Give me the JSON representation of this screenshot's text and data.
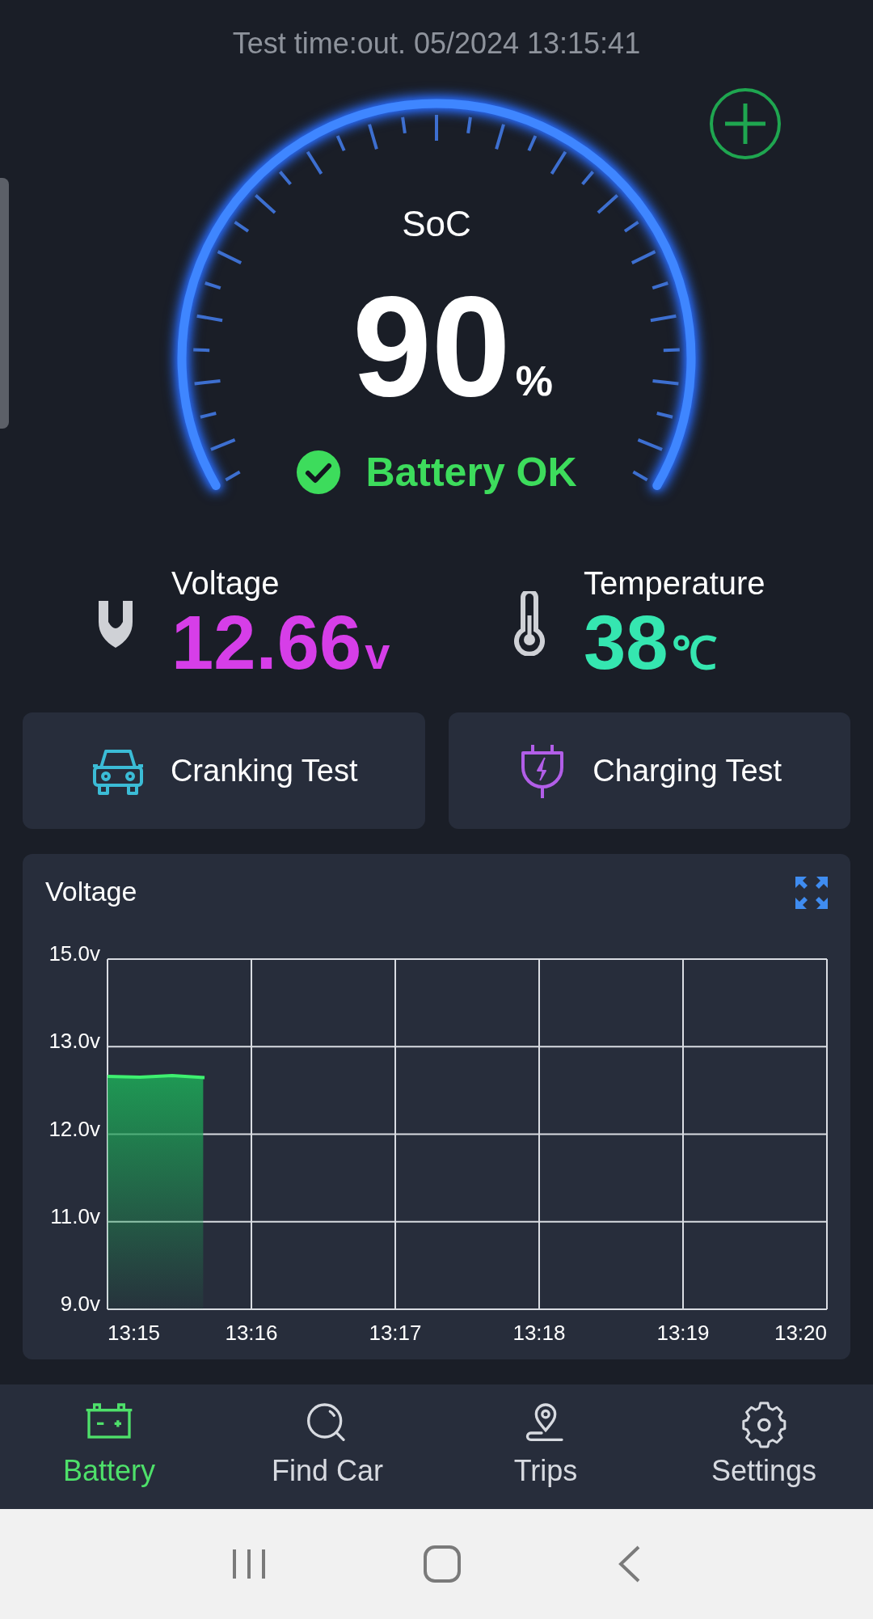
{
  "header": {
    "test_time": "Test time:out. 05/2024 13:15:41"
  },
  "gauge": {
    "label": "SoC",
    "value": "90",
    "unit": "%"
  },
  "status": {
    "kind": "ok",
    "text": "Battery OK"
  },
  "readings": [
    {
      "kind": "voltage",
      "label": "Voltage",
      "value": "12.66",
      "unit": "v"
    },
    {
      "kind": "temperature",
      "label": "Temperature",
      "value": "38",
      "unit": "℃"
    }
  ],
  "tests": [
    {
      "kind": "cranking",
      "label": "Cranking Test"
    },
    {
      "kind": "charging",
      "label": "Charging Test"
    }
  ],
  "chart": {
    "title": "Voltage",
    "y_labels": [
      "15.0v",
      "13.0v",
      "12.0v",
      "11.0v",
      "9.0v"
    ],
    "x_labels": [
      "13:15",
      "13:16",
      "13:17",
      "13:18",
      "13:19",
      "13:20"
    ]
  },
  "nav": [
    {
      "kind": "battery",
      "label": "Battery",
      "selected": true
    },
    {
      "kind": "find",
      "label": "Find Car",
      "selected": false
    },
    {
      "kind": "trips",
      "label": "Trips",
      "selected": false
    },
    {
      "kind": "settings",
      "label": "Settings",
      "selected": false
    }
  ]
}
